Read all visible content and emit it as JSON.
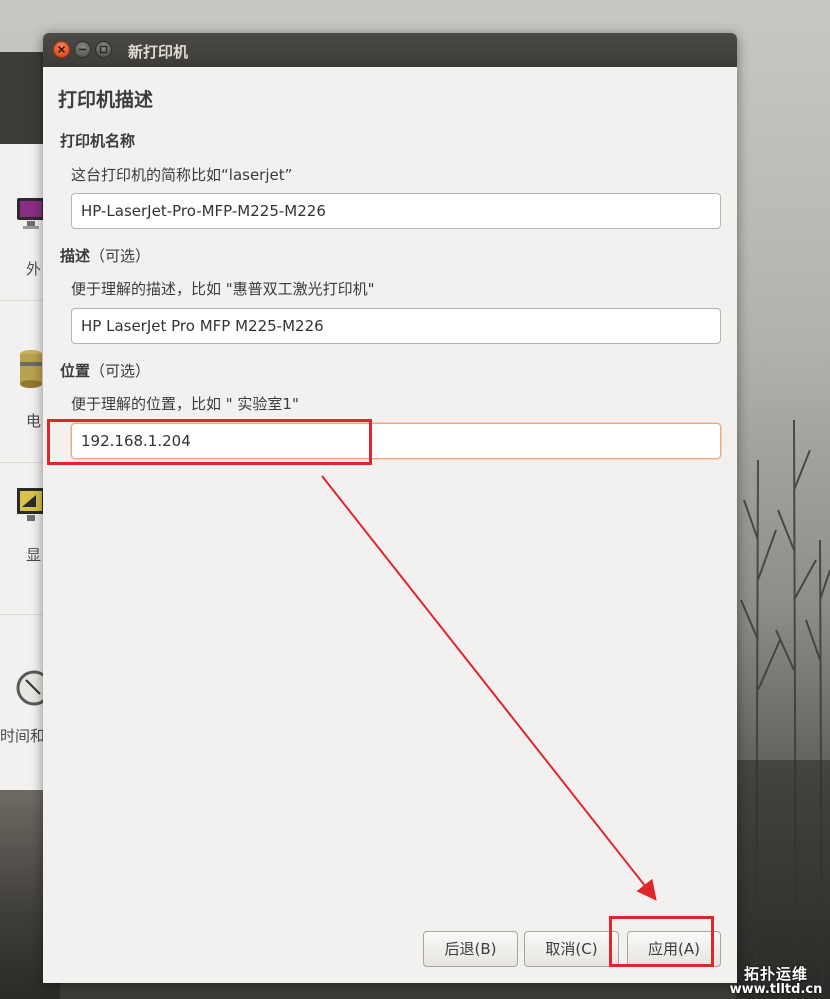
{
  "dialog": {
    "title": "新打印机",
    "section_heading": "打印机描述",
    "name_group": {
      "label": "打印机名称",
      "hint": "这台打印机的简称比如“laserjet”",
      "value": "HP-LaserJet-Pro-MFP-M225-M226"
    },
    "description_group": {
      "label": "描述",
      "optional": "（可选）",
      "hint": "便于理解的描述，比如 \"惠普双工激光打印机\"",
      "value": "HP LaserJet Pro MFP M225-M226"
    },
    "location_group": {
      "label": "位置",
      "optional": "（可选）",
      "hint": "便于理解的位置，比如 \" 实验室1\"",
      "value": "192.168.1.204"
    },
    "buttons": {
      "back": "后退(B)",
      "cancel": "取消(C)",
      "apply": "应用(A)"
    }
  },
  "background_window": {
    "labels": [
      "外",
      "电",
      "显",
      "时间和"
    ]
  },
  "watermark": {
    "text": "拓扑运维",
    "url": "www.tlltd.cn"
  },
  "colors": {
    "annotation": "#e0262b",
    "titlebar": "#3c3b37",
    "close_button": "#e2511f"
  }
}
